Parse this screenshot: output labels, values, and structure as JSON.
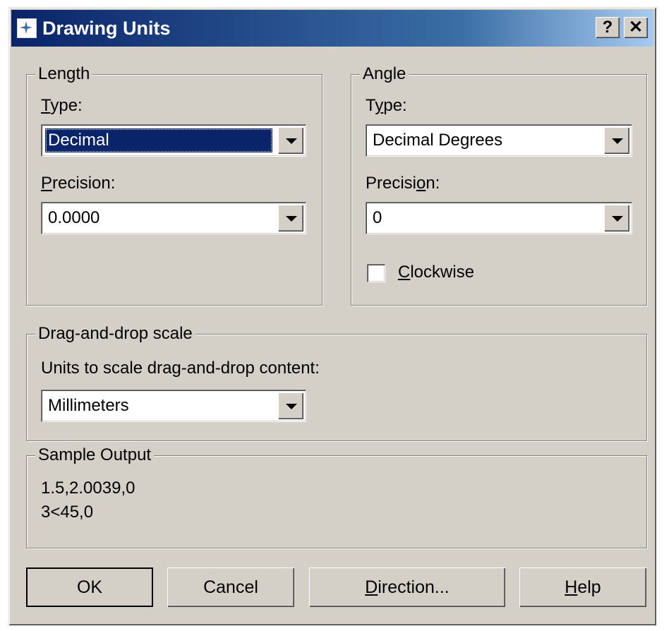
{
  "window": {
    "title": "Drawing Units",
    "help_button": "?",
    "close_button": "✕"
  },
  "length": {
    "group_label": "Length",
    "type_label": "Type:",
    "type_value": "Decimal",
    "precision_label": "Precision:",
    "precision_value": "0.0000"
  },
  "angle": {
    "group_label": "Angle",
    "type_label": "Type:",
    "type_value": "Decimal Degrees",
    "precision_label": "Precision:",
    "precision_value": "0",
    "clockwise_label": "Clockwise",
    "clockwise_checked": false
  },
  "dragdrop": {
    "group_label": "Drag-and-drop scale",
    "units_label": "Units to scale drag-and-drop content:",
    "units_value": "Millimeters"
  },
  "sample": {
    "group_label": "Sample Output",
    "line1": "1.5,2.0039,0",
    "line2": "3<45,0"
  },
  "buttons": {
    "ok": "OK",
    "cancel": "Cancel",
    "direction": "Direction...",
    "help": "Help"
  },
  "colors": {
    "title_gradient_start": "#0a246a",
    "face": "#d4d0c8",
    "selection": "#0a246a"
  }
}
